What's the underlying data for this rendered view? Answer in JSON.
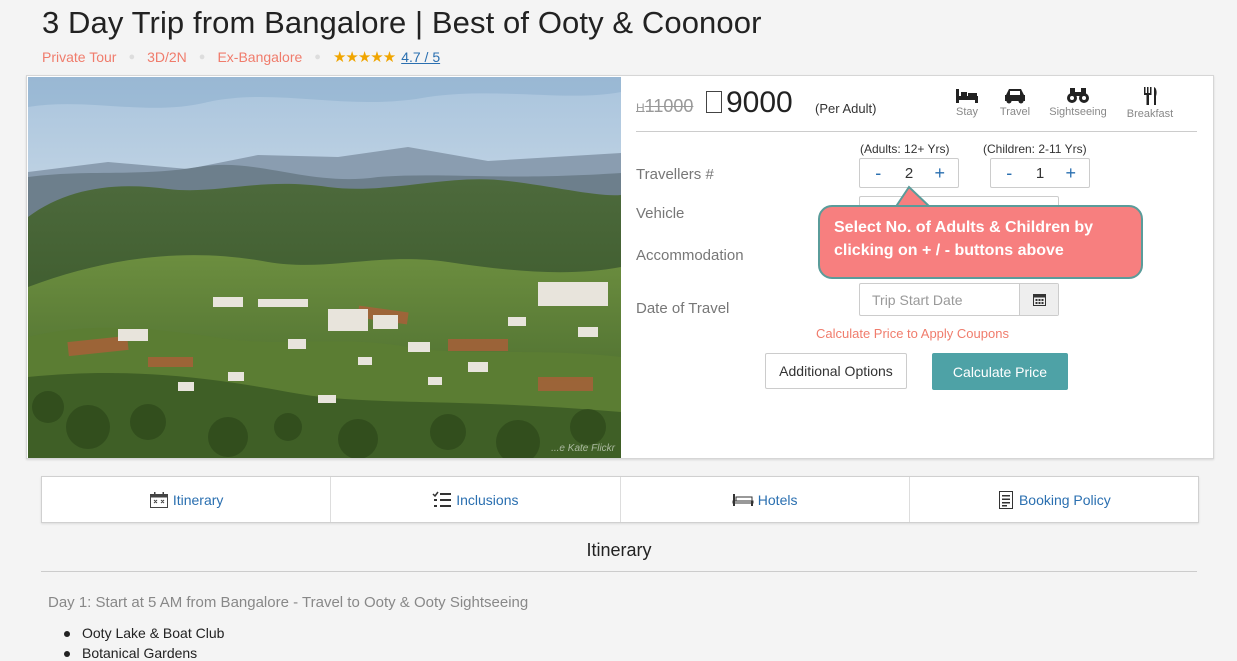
{
  "title": "3 Day Trip from Bangalore | Best of Ooty & Coonoor",
  "meta": {
    "tags": [
      "Private Tour",
      "3D/2N",
      "Ex-Bangalore"
    ],
    "stars": "★★★★★",
    "rating": "4.7 / 5"
  },
  "photo": {
    "credit": "...e Kate Flickr"
  },
  "price": {
    "old": "11000",
    "new": "9000",
    "unit": "(Per Adult)"
  },
  "amenities": [
    {
      "label": "Stay",
      "icon": "bed-icon"
    },
    {
      "label": "Travel",
      "icon": "car-icon"
    },
    {
      "label": "Sightseeing",
      "icon": "binoculars-icon"
    },
    {
      "label": "Breakfast",
      "icon": "fork-knife-icon"
    }
  ],
  "form": {
    "travellers_label": "Travellers #",
    "vehicle_label": "Vehicle",
    "accommodation_label": "Accommodation",
    "date_label": "Date of Travel",
    "adults_label": "(Adults: 12+ Yrs)",
    "children_label": "(Children: 2-11 Yrs)",
    "adults_value": "2",
    "children_value": "1",
    "minus": "-",
    "plus": "+",
    "date_placeholder": "Trip Start Date",
    "coupon_text": "Calculate Price to Apply Coupons",
    "additional_options": "Additional Options",
    "calculate_price": "Calculate Price"
  },
  "callout": {
    "line1": "Select No. of Adults & Children by",
    "line2": "clicking on + / - buttons above"
  },
  "tabs": [
    {
      "label": "Itinerary",
      "icon": "calendar-icon"
    },
    {
      "label": "Inclusions",
      "icon": "list-icon"
    },
    {
      "label": "Hotels",
      "icon": "bed-icon"
    },
    {
      "label": "Booking Policy",
      "icon": "document-icon"
    }
  ],
  "itinerary": {
    "heading": "Itinerary",
    "day1": "Day 1: Start at 5 AM from Bangalore - Travel to Ooty & Ooty Sightseeing",
    "items": [
      "Ooty Lake & Boat Club",
      "Botanical Gardens"
    ]
  },
  "colors": {
    "accent": "#4ea2a6",
    "link": "#2a6fb0",
    "tag": "#f07c6c",
    "callout": "#f77f7f"
  }
}
